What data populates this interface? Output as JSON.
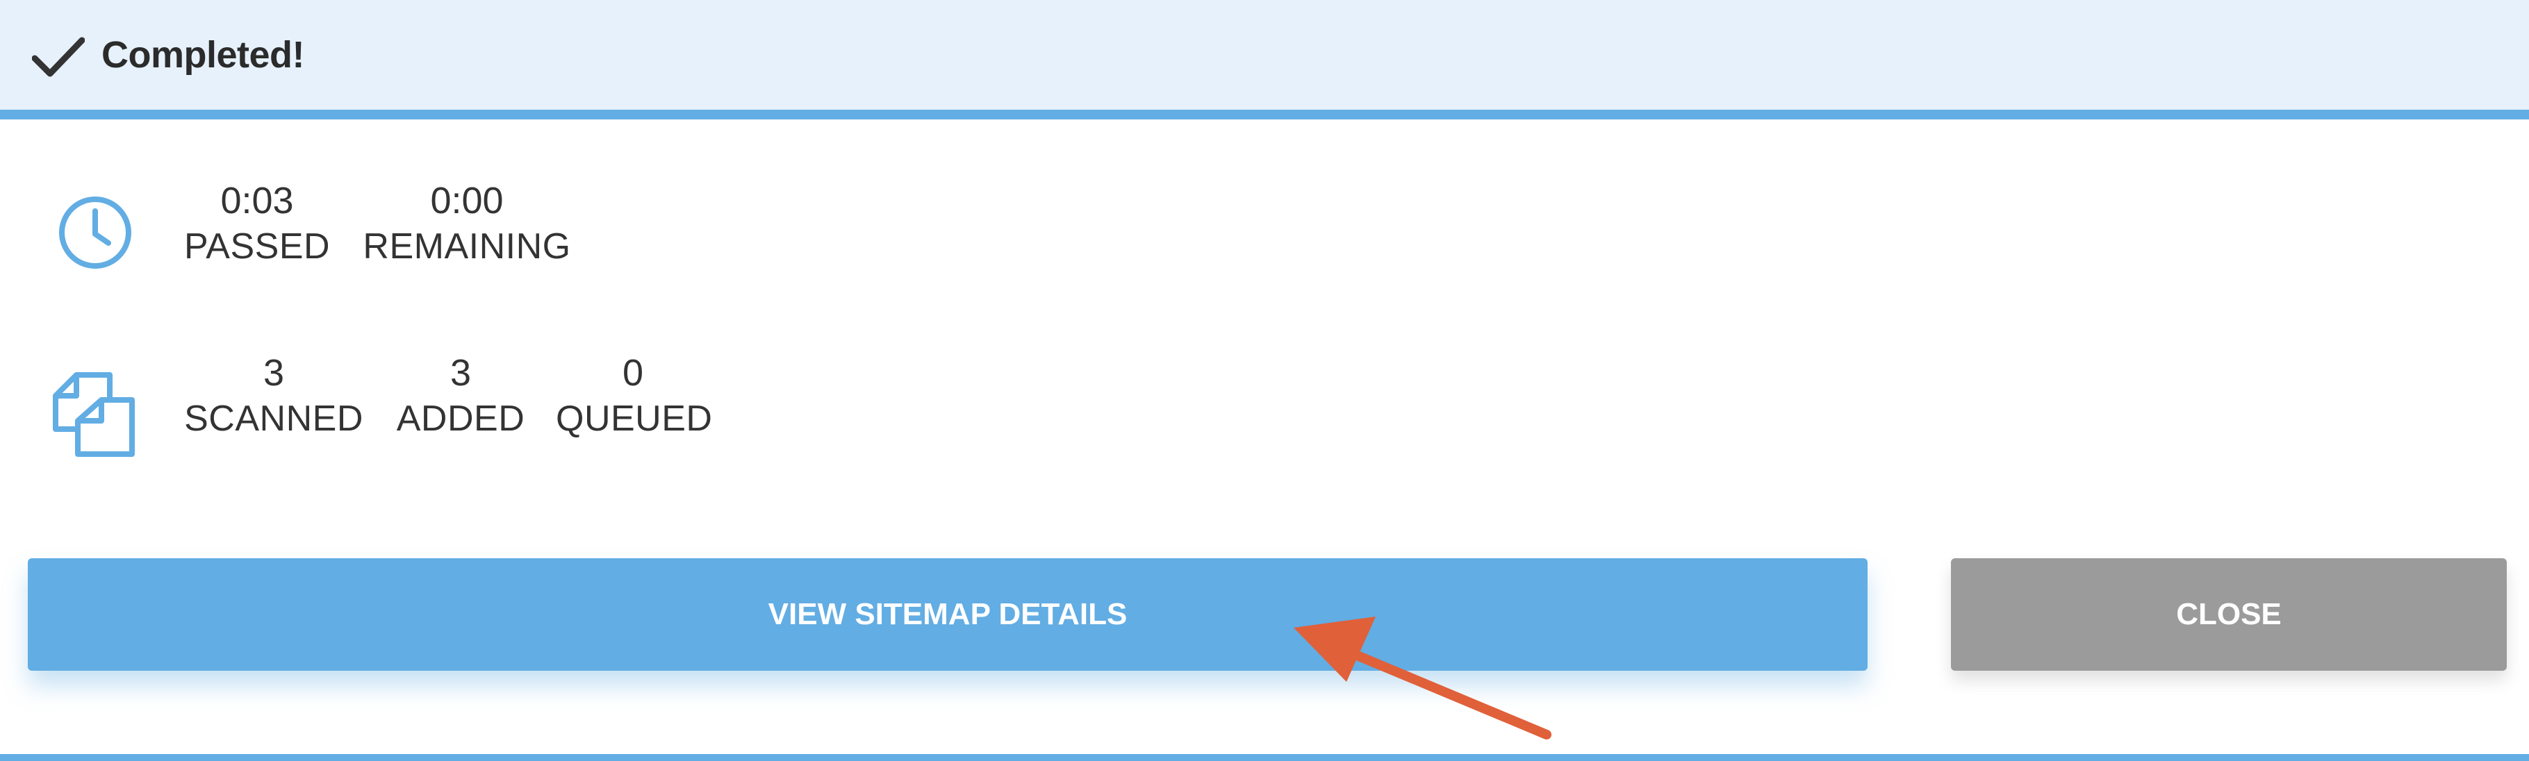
{
  "header": {
    "title": "Completed!",
    "icon": "check-icon"
  },
  "time_stats": {
    "icon": "clock-icon",
    "items": [
      {
        "value": "0:03",
        "label": "PASSED"
      },
      {
        "value": "0:00",
        "label": "REMAINING"
      }
    ]
  },
  "page_stats": {
    "icon": "pages-icon",
    "items": [
      {
        "value": "3",
        "label": "SCANNED"
      },
      {
        "value": "3",
        "label": "ADDED"
      },
      {
        "value": "0",
        "label": "QUEUED"
      }
    ]
  },
  "actions": {
    "view_label": "VIEW SITEMAP DETAILS",
    "close_label": "CLOSE"
  },
  "colors": {
    "accent": "#62ade3",
    "header_bg": "#e6f1fb",
    "close_bg": "#9b9b9b",
    "annotation_arrow": "#e0603a"
  }
}
